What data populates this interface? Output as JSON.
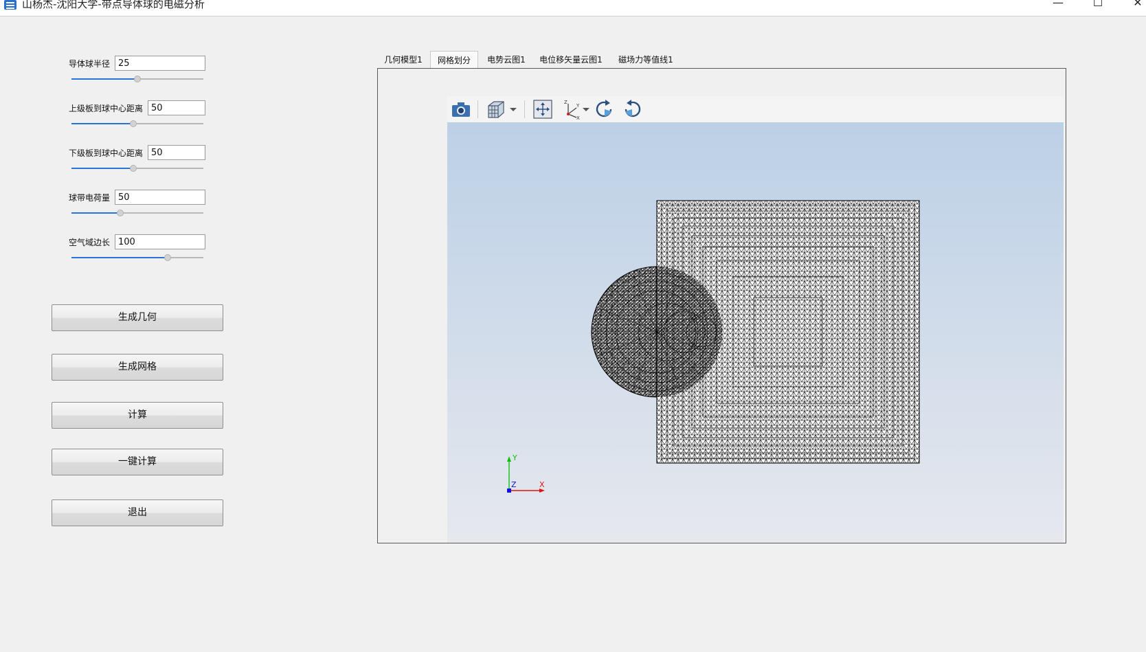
{
  "window": {
    "title": "山杨杰-沈阳大学-带点导体球的电磁分析",
    "minimize": "—",
    "maximize": "☐",
    "close": "✕"
  },
  "params": [
    {
      "label": "导体球半径",
      "value": "25",
      "slider_fraction": 0.5
    },
    {
      "label": "上级板到球中心距离",
      "value": "50",
      "slider_fraction": 0.47
    },
    {
      "label": "下级板到球中心距离",
      "value": "50",
      "slider_fraction": 0.47
    },
    {
      "label": "球带电荷量",
      "value": "50",
      "slider_fraction": 0.37
    },
    {
      "label": "空气域边长",
      "value": "100",
      "slider_fraction": 0.73
    }
  ],
  "buttons": {
    "generate_geometry": "生成几何",
    "generate_mesh": "生成网格",
    "compute": "计算",
    "one_click_compute": "一键计算",
    "exit": "退出"
  },
  "tabs": [
    {
      "label": "几何模型1",
      "active": false
    },
    {
      "label": "网格划分",
      "active": true
    },
    {
      "label": "电势云图1",
      "active": false
    },
    {
      "label": "电位移矢量云图1",
      "active": false
    },
    {
      "label": "磁场力等值线1",
      "active": false
    }
  ],
  "toolbar_icons": [
    "camera-icon",
    "view-cube-icon",
    "dropdown-arrow-icon",
    "zoom-extents-icon",
    "axis-triad-icon",
    "dropdown-arrow-icon",
    "rotate-right-icon",
    "rotate-left-icon"
  ],
  "axes": {
    "x": "X",
    "y": "Y",
    "z": "Z",
    "x_color": "#e01010",
    "y_color": "#10c010",
    "z_color": "#1010e0"
  },
  "colors": {
    "slider_fill": "#2a73d6",
    "canvas_top": "#bcd0e6",
    "canvas_bottom": "#e6e8ee",
    "mesh": "#000000"
  }
}
